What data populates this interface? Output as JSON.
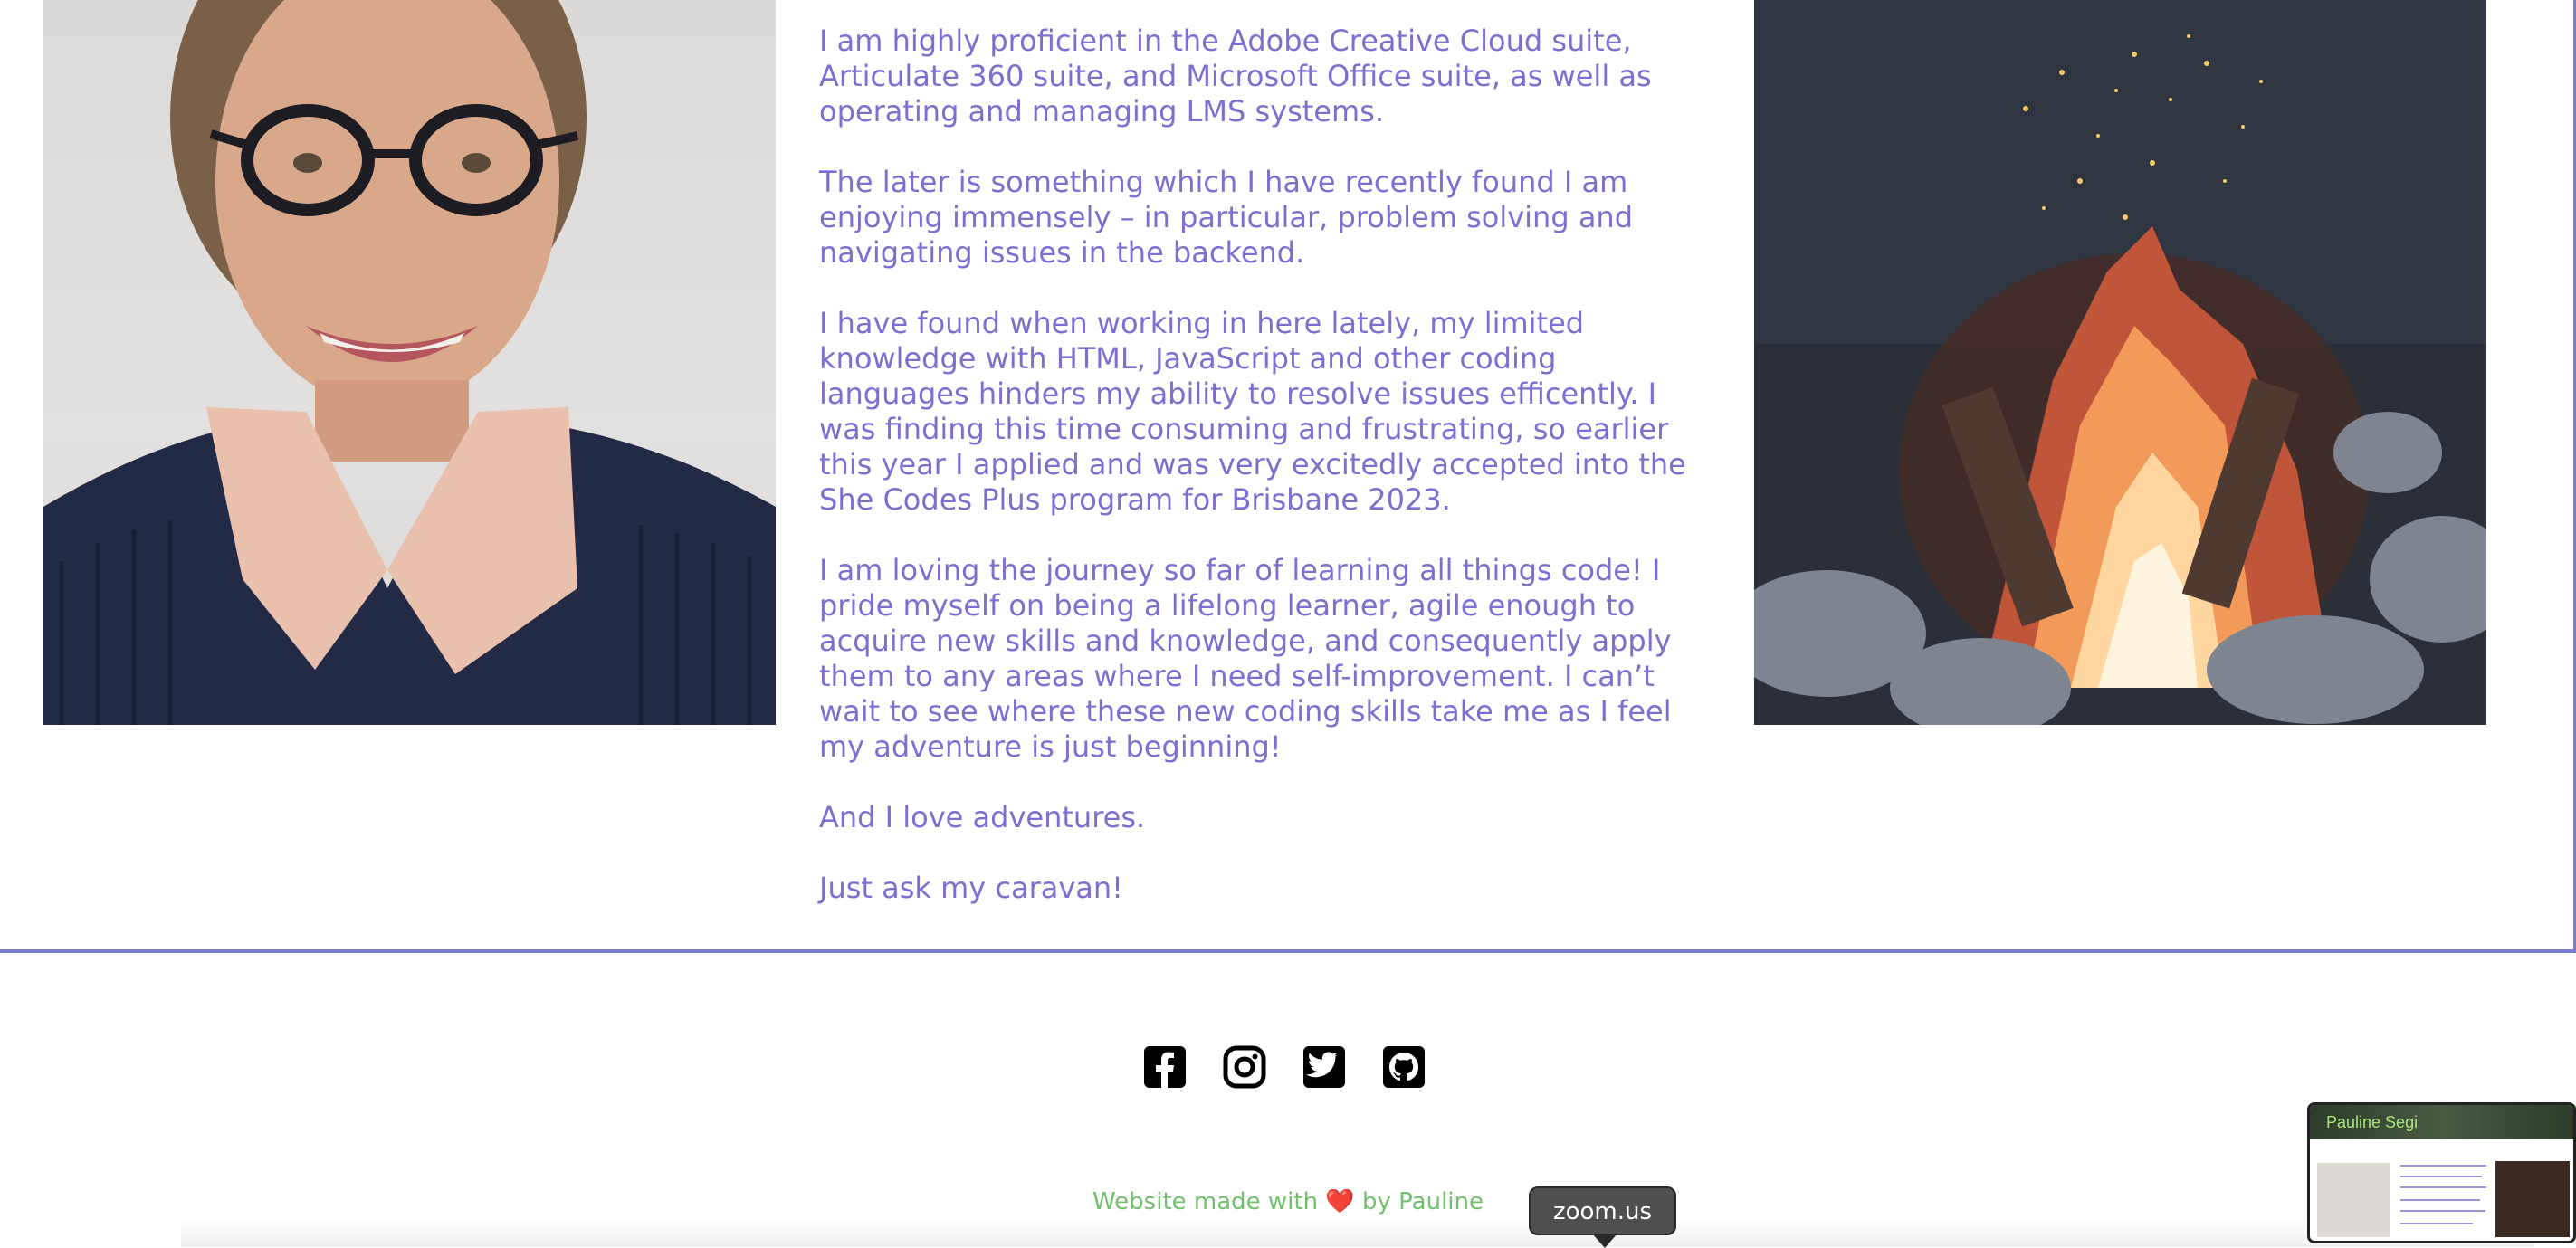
{
  "bio": {
    "paragraphs": [
      "I am highly proficient in the Adobe Creative Cloud suite, Articulate 360 suite, and Microsoft Office suite, as well as operating and managing LMS systems.",
      "The later is something which I have recently found I am enjoying immensely – in particular, problem solving and navigating issues in the backend.",
      "I have found when working in here lately, my limited knowledge with HTML, JavaScript and other coding languages hinders my ability to resolve issues efficently. I was finding this time consuming and frustrating, so earlier this year I applied and was very excitedly accepted into the She Codes Plus program for Brisbane 2023.",
      "I am loving the journey so far of learning all things code! I pride myself on being a lifelong learner, agile enough to acquire new skills and knowledge, and consequently apply them to any areas where I need self-improvement. I can’t wait to see where these new coding skills take me as I feel my adventure is just beginning!",
      "And I love adventures.",
      "Just ask my caravan!"
    ]
  },
  "social_icons": [
    "facebook-icon",
    "instagram-icon",
    "twitter-icon",
    "github-icon"
  ],
  "footer": {
    "prefix": "Website made with",
    "heart": "❤️",
    "suffix": "by Pauline"
  },
  "tooltip": {
    "label": "zoom.us"
  },
  "thumbnail": {
    "title": "Pauline Segi"
  },
  "colors": {
    "text_purple": "#7b6fd1",
    "border_purple": "#7b7bd0",
    "footer_green": "#72c06e"
  }
}
